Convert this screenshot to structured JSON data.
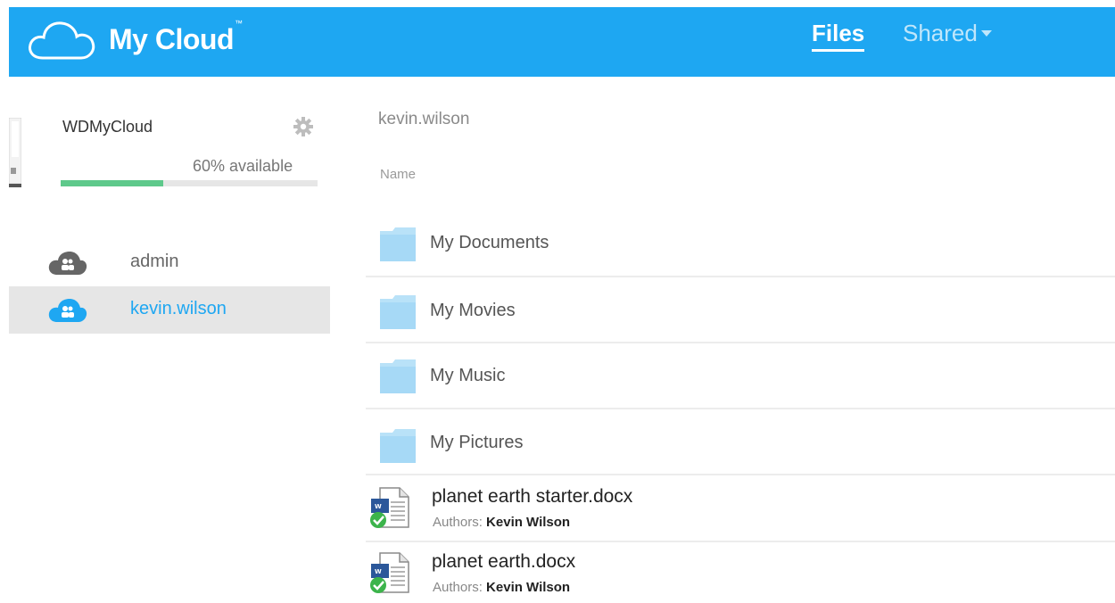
{
  "header": {
    "brand": "My Cloud",
    "trademark": "™",
    "tabs": [
      {
        "label": "Files",
        "active": true
      },
      {
        "label": "Shared",
        "active": false
      }
    ],
    "accent_color": "#1ea7f2"
  },
  "device": {
    "name": "WDMyCloud",
    "available_text": "60% available",
    "used_fraction": 0.4
  },
  "users": [
    {
      "name": "admin",
      "selected": false
    },
    {
      "name": "kevin.wilson",
      "selected": true
    }
  ],
  "main": {
    "breadcrumb": "kevin.wilson",
    "column_header": "Name",
    "folders": [
      "My Documents",
      "My Movies",
      "My Music",
      "My Pictures"
    ],
    "documents": [
      {
        "name": "planet earth starter.docx",
        "authors_label": "Authors:",
        "author": "Kevin Wilson"
      },
      {
        "name": "planet earth.docx",
        "authors_label": "Authors:",
        "author": "Kevin Wilson"
      }
    ]
  }
}
